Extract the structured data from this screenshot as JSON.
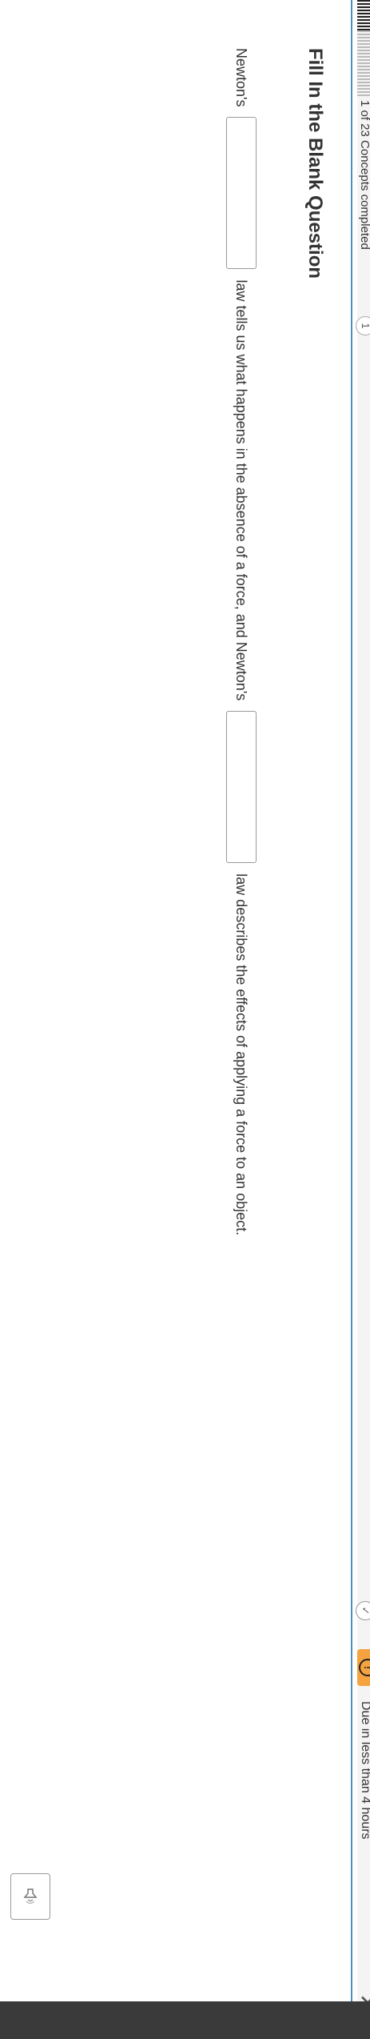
{
  "header": {
    "concepts_completed": "1 of 23 Concepts completed",
    "concepts_badge": "1",
    "check_icon": "check-circle-icon",
    "due_icon": "!",
    "due_text": "Due in less than 4 hours",
    "close_label": "✕"
  },
  "main": {
    "title": "Fill In the Blank Question",
    "question": {
      "part1": "Newton's",
      "part2": "law tells us what happens in the absence of a force, and Newton's",
      "part3": "law describes the effects of applying a force to an object.",
      "blank1_value": "",
      "blank2_value": ""
    },
    "read_aloud_icon": "speaker-icon"
  },
  "colors": {
    "divider": "#4a90c8",
    "due_badge": "#f4a340"
  }
}
